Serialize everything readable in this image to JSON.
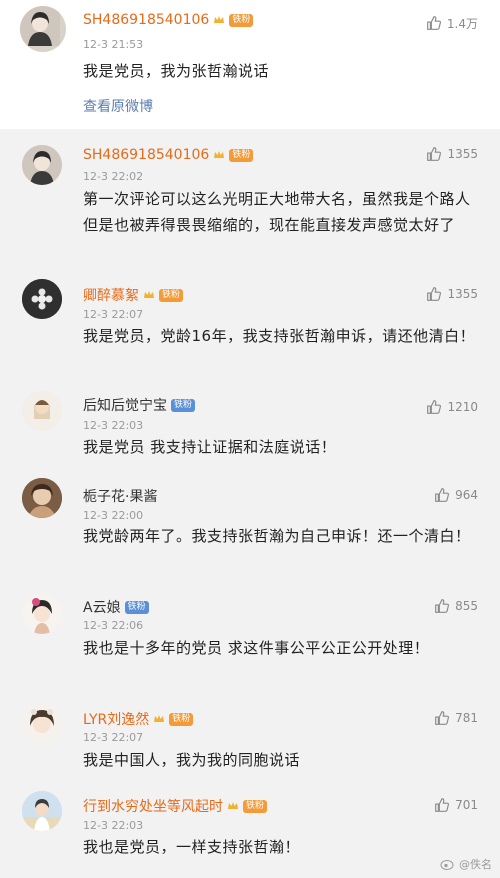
{
  "colors": {
    "username": "#e86a19",
    "link": "#5b7fb0",
    "badge": "#f29b38",
    "badge_blue": "#5b8fd6"
  },
  "top_comment": {
    "username": "SH486918540106",
    "badge": "铁粉",
    "time": "12-3 21:53",
    "likes": "1.4万",
    "text": "我是党员，我为张哲瀚说话",
    "view_original": "查看原微博"
  },
  "replies": [
    {
      "username": "SH486918540106",
      "badge": "铁粉",
      "time": "12-3 22:02",
      "likes": "1355",
      "text": "第一次评论可以这么光明正大地带大名，虽然我是个路人但是也被弄得畏畏缩缩的，现在能直接发声感觉太好了"
    },
    {
      "username": "卿醉慕絮",
      "badge": "铁粉",
      "time": "12-3 22:07",
      "likes": "1355",
      "text": "我是党员，党龄16年，我支持张哲瀚申诉，请还他清白！"
    },
    {
      "username": "后知后觉宁宝",
      "badge": "铁粉",
      "time": "12-3 22:03",
      "likes": "1210",
      "text": "我是党员 我支持让证据和法庭说话！"
    },
    {
      "username": "栀子花·果酱",
      "badge": "",
      "time": "12-3 22:00",
      "likes": "964",
      "text": "我党龄两年了。我支持张哲瀚为自己申诉！还一个清白！"
    },
    {
      "username": "A云娘",
      "badge": "铁粉",
      "time": "12-3 22:06",
      "likes": "855",
      "text": "我也是十多年的党员 求这件事公平公正公开处理！"
    },
    {
      "username": "LYR刘逸然",
      "badge": "铁粉",
      "time": "12-3 22:07",
      "likes": "781",
      "text": "我是中国人，我为我的同胞说话"
    },
    {
      "username": "行到水穷处坐等风起时",
      "badge": "铁粉",
      "time": "12-3 22:03",
      "likes": "701",
      "text": "我也是党员，一样支持张哲瀚！"
    }
  ],
  "watermark": "@佚名"
}
